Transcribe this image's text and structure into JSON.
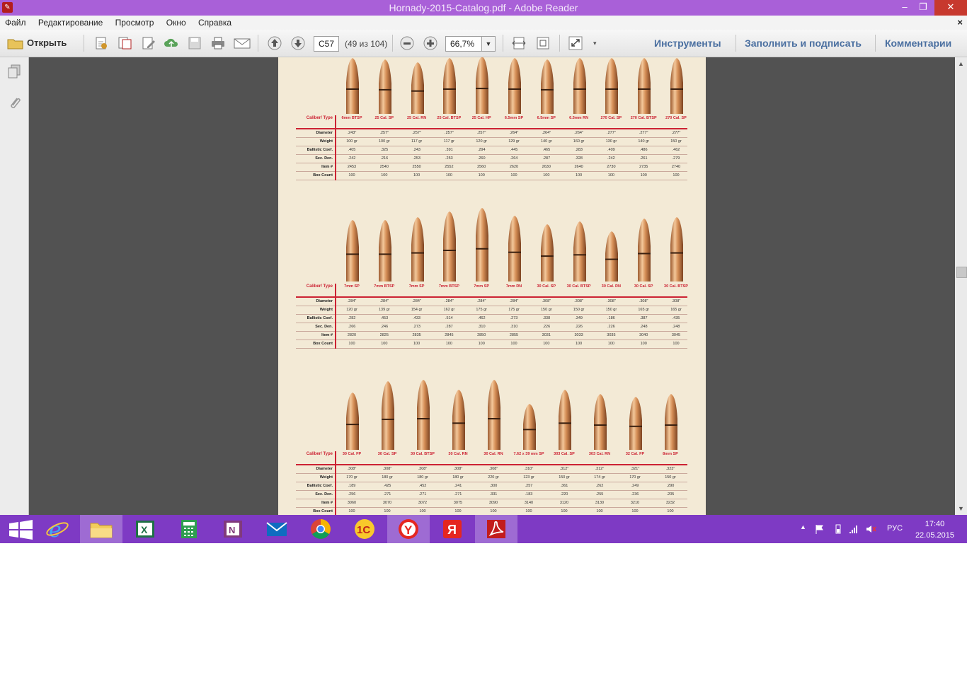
{
  "window": {
    "title": "Hornady-2015-Catalog.pdf - Adobe Reader",
    "minimize": "–",
    "restore": "❐",
    "close": "✕"
  },
  "menu": [
    "Файл",
    "Редактирование",
    "Просмотр",
    "Окно",
    "Справка"
  ],
  "menu_close": "×",
  "toolbar": {
    "open_label": "Открыть",
    "page_value": "C57",
    "page_count": "(49 из 104)",
    "zoom_value": "66,7%",
    "tools_label": "Инструменты",
    "fill_sign_label": "Заполнить и подписать",
    "comments_label": "Комментарии"
  },
  "catalog": {
    "row_labels": [
      "Caliber/ Type",
      "Diameter",
      "Weight",
      "Ballistic Coef.",
      "Sec. Den.",
      "Item #",
      "Box Count"
    ],
    "block1": {
      "headers": [
        "6mm BTSP",
        "25 Cal. SP",
        "25 Cal. RN",
        "25 Cal. BTSP",
        "25 Cal. HP",
        "6.5mm SP",
        "6.5mm SP",
        "6.5mm RN",
        "270 Cal. SP",
        "270 Cal. BTSP",
        "270 Cal. SP"
      ],
      "rows": [
        [
          "",
          ".243\"",
          ".257\"",
          ".257\"",
          ".257\"",
          ".257\"",
          ".264\"",
          ".264\"",
          ".264\"",
          ".277\"",
          ".277\"",
          ".277\""
        ],
        [
          "",
          "100 gr",
          "100 gr",
          "117 gr",
          "117 gr",
          "120 gr",
          "129 gr",
          "140 gr",
          "160 gr",
          "130 gr",
          "140 gr",
          "150 gr"
        ],
        [
          "",
          ".405",
          ".325",
          ".243",
          ".391",
          ".294",
          ".445",
          ".465",
          ".283",
          ".409",
          ".486",
          ".462"
        ],
        [
          "",
          ".242",
          ".216",
          ".253",
          ".253",
          ".260",
          ".264",
          ".287",
          ".328",
          ".242",
          ".261",
          ".279"
        ],
        [
          "",
          "2453",
          "2540",
          "2550",
          "2552",
          "2560",
          "2620",
          "2630",
          "2640",
          "2730",
          "2735",
          "2740"
        ],
        [
          "",
          "100",
          "100",
          "100",
          "100",
          "100",
          "100",
          "100",
          "100",
          "100",
          "100",
          "100"
        ]
      ]
    },
    "block2": {
      "headers": [
        "7mm SP",
        "7mm BTSP",
        "7mm SP",
        "7mm BTSP",
        "7mm SP",
        "7mm RN",
        "30 Cal. SP",
        "30 Cal. BTSP",
        "30 Cal. RN",
        "30 Cal. SP",
        "30 Cal. BTSP"
      ],
      "rows": [
        [
          "",
          ".284\"",
          ".284\"",
          ".284\"",
          ".284\"",
          ".284\"",
          ".284\"",
          ".308\"",
          ".308\"",
          ".308\"",
          ".308\"",
          ".308\""
        ],
        [
          "",
          "120 gr",
          "139 gr",
          "154 gr",
          "162 gr",
          "175 gr",
          "175 gr",
          "150 gr",
          "150 gr",
          "150 gr",
          "165 gr",
          "165 gr"
        ],
        [
          "",
          ".282",
          ".453",
          ".433",
          ".514",
          ".462",
          ".273",
          ".338",
          ".349",
          ".186",
          ".387",
          ".435"
        ],
        [
          "",
          ".266",
          ".246",
          ".273",
          ".287",
          ".310",
          ".310",
          ".226",
          ".226",
          ".226",
          ".248",
          ".248"
        ],
        [
          "",
          "2820",
          "2825",
          "2835",
          "2845",
          "2850",
          "2855",
          "3031",
          "3033",
          "3035",
          "3040",
          "3045"
        ],
        [
          "",
          "100",
          "100",
          "100",
          "100",
          "100",
          "100",
          "100",
          "100",
          "100",
          "100",
          "100"
        ]
      ]
    },
    "block3": {
      "headers": [
        "30 Cal. FP",
        "30 Cal. SP",
        "30 Cal. BTSP",
        "30 Cal. RN",
        "30 Cal. RN",
        "7.62 x 39 mm SP",
        "303 Cal. SP",
        "303 Cal. RN",
        "32 Cal. FP",
        "8mm SP"
      ],
      "rows": [
        [
          "",
          ".308\"",
          ".308\"",
          ".308\"",
          ".308\"",
          ".308\"",
          ".310\"",
          ".312\"",
          ".312\"",
          ".321\"",
          ".323\""
        ],
        [
          "",
          "170 gr",
          "180 gr",
          "180 gr",
          "180 gr",
          "220 gr",
          "123 gr",
          "150 gr",
          "174 gr",
          "170 gr",
          "150 gr"
        ],
        [
          "",
          ".189",
          ".425",
          ".452",
          ".241",
          ".300",
          ".257",
          ".361",
          ".262",
          ".249",
          ".290"
        ],
        [
          "",
          ".256",
          ".271",
          ".271",
          ".271",
          ".331",
          ".183",
          ".220",
          ".255",
          ".236",
          ".205"
        ],
        [
          "",
          "3060",
          "3070",
          "3072",
          "3075",
          "3090",
          "3140",
          "3120",
          "3130",
          "3210",
          "3232"
        ],
        [
          "",
          "100",
          "100",
          "100",
          "100",
          "100",
          "100",
          "100",
          "100",
          "100",
          "100"
        ]
      ]
    }
  },
  "taskbar": {
    "apps": [
      "windows-start",
      "internet-explorer",
      "file-explorer",
      "excel",
      "calculator",
      "onenote",
      "mail",
      "chrome",
      "1c",
      "yandex-browser",
      "yandex",
      "adobe-reader"
    ],
    "language": "РУС",
    "time": "17:40",
    "date": "22.05.2015"
  }
}
